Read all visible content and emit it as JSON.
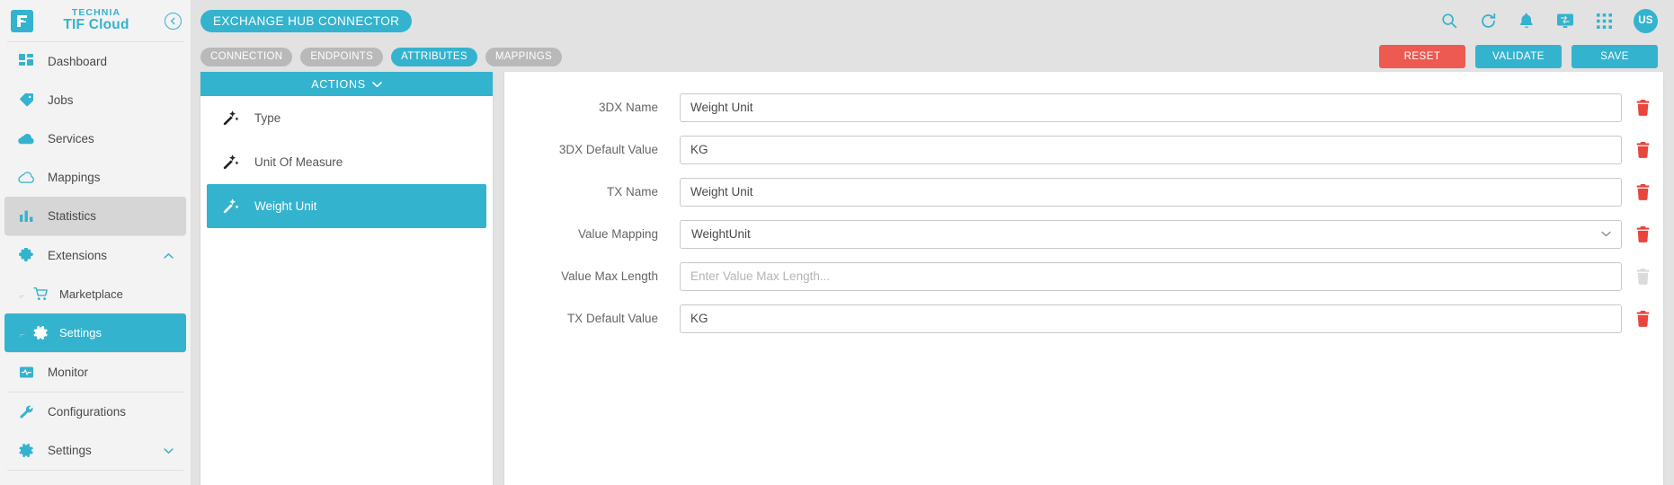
{
  "sidebar": {
    "brand": {
      "top": "TECHNIA",
      "bottom": "TIF Cloud",
      "logo_letter": "F",
      "collapse_icon": "collapse-left-icon"
    },
    "items": [
      {
        "label": "Dashboard",
        "icon": "dashboard-icon",
        "state": "normal"
      },
      {
        "label": "Jobs",
        "icon": "tag-icon",
        "state": "normal"
      },
      {
        "label": "Services",
        "icon": "cloud-filled-icon",
        "state": "normal"
      },
      {
        "label": "Mappings",
        "icon": "cloud-outline-icon",
        "state": "normal"
      },
      {
        "label": "Statistics",
        "icon": "bar-chart-icon",
        "state": "active"
      },
      {
        "label": "Extensions",
        "icon": "puzzle-icon",
        "state": "normal",
        "chevron": "chevron-up-icon"
      },
      {
        "label": "Marketplace",
        "icon": "cart-icon",
        "state": "normal",
        "sub": true
      },
      {
        "label": "Settings",
        "icon": "gear-icon",
        "state": "selected",
        "sub": true
      },
      {
        "label": "Monitor",
        "icon": "monitor-pulse-icon",
        "state": "normal"
      },
      {
        "label": "Configurations",
        "icon": "wrench-icon",
        "state": "normal"
      },
      {
        "label": "Settings",
        "icon": "gear-icon",
        "state": "normal",
        "chevron": "chevron-down-icon"
      }
    ]
  },
  "header": {
    "title": "EXCHANGE HUB CONNECTOR",
    "icons": [
      "search-icon",
      "refresh-icon",
      "bell-icon",
      "console-icon",
      "grid-apps-icon"
    ],
    "avatar_initials": "US"
  },
  "tabs": [
    {
      "label": "CONNECTION",
      "active": false
    },
    {
      "label": "ENDPOINTS",
      "active": false
    },
    {
      "label": "ATTRIBUTES",
      "active": true
    },
    {
      "label": "MAPPINGS",
      "active": false
    }
  ],
  "toolbar": {
    "reset_label": "RESET",
    "validate_label": "VALIDATE",
    "save_label": "SAVE"
  },
  "actions_panel": {
    "header_label": "ACTIONS",
    "header_chevron": "chevron-down-icon",
    "items": [
      {
        "label": "Type",
        "icon": "wand-icon",
        "selected": false
      },
      {
        "label": "Unit Of Measure",
        "icon": "wand-icon",
        "selected": false
      },
      {
        "label": "Weight Unit",
        "icon": "wand-icon",
        "selected": true
      }
    ]
  },
  "form": {
    "rows": [
      {
        "label": "3DX Name",
        "value": "Weight Unit",
        "placeholder": "",
        "type": "text",
        "delete_enabled": true
      },
      {
        "label": "3DX Default Value",
        "value": "KG",
        "placeholder": "",
        "type": "text",
        "delete_enabled": true
      },
      {
        "label": "TX Name",
        "value": "Weight Unit",
        "placeholder": "",
        "type": "text",
        "delete_enabled": true
      },
      {
        "label": "Value Mapping",
        "value": "WeightUnit",
        "placeholder": "",
        "type": "select",
        "delete_enabled": true
      },
      {
        "label": "Value Max Length",
        "value": "",
        "placeholder": "Enter Value Max Length...",
        "type": "text",
        "delete_enabled": false
      },
      {
        "label": "TX Default Value",
        "value": "KG",
        "placeholder": "",
        "type": "text",
        "delete_enabled": true
      }
    ],
    "delete_icon": "trash-icon"
  },
  "colors": {
    "accent": "#34b3ce",
    "danger": "#ec5a52",
    "tab_inactive": "#b9b9b9",
    "page_bg": "#e2e2e2"
  }
}
